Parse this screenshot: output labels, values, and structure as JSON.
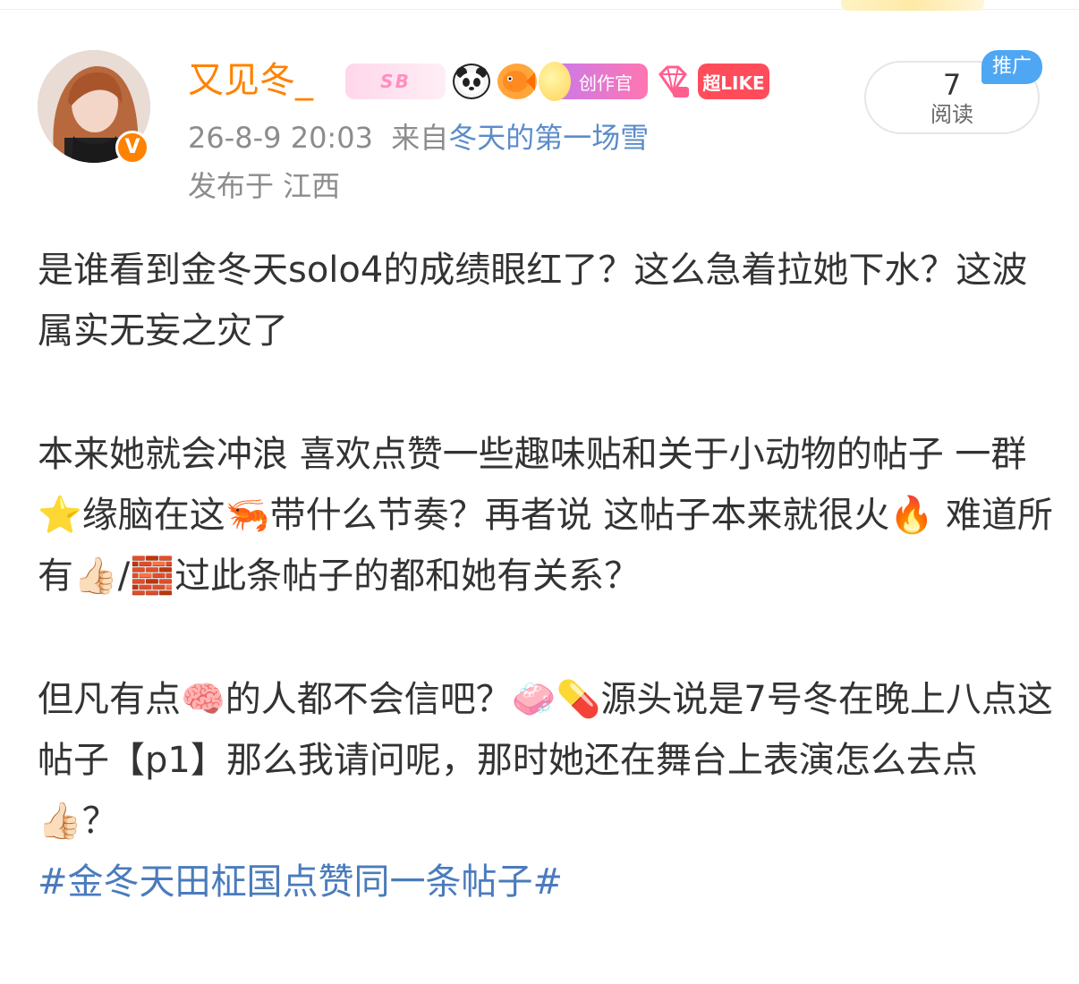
{
  "post": {
    "username": "又见冬_",
    "timestamp": "26-8-9 20:03",
    "source_prefix": "来自",
    "source_name": "冬天的第一场雪",
    "location": "发布于 江西",
    "badges": {
      "sb": "SB",
      "creator": "创作官",
      "like": "超LIKE",
      "panda": "panda-icon",
      "fish": "fish-icon",
      "gem": "gem-icon"
    },
    "read_count": "7",
    "read_label": "阅读",
    "promo_label": "推广",
    "verified_mark": "V",
    "colors": {
      "username": "#ff8200",
      "link": "#5b8cc9",
      "topic": "#4a7bbd",
      "promo": "#4fa7f3"
    },
    "paragraphs": [
      "是谁看到金冬天solo4的成绩眼红了？这么急着拉她下水？这波属实无妄之灾了",
      "本来她就会冲浪 喜欢点赞一些趣味贴和关于小动物的帖子 一群⭐缘脑在这🦐带什么节奏？再者说 这帖子本来就很火🔥 难道所有👍🏻/🧱过此条帖子的都和她有关系？",
      "但凡有点🧠的人都不会信吧？🧼💊源头说是7号冬在晚上八点这帖子【p1】那么我请问呢，那时她还在舞台上表演怎么去点👍🏻？"
    ],
    "topic": "#金冬天田柾国点赞同一条帖子#"
  }
}
